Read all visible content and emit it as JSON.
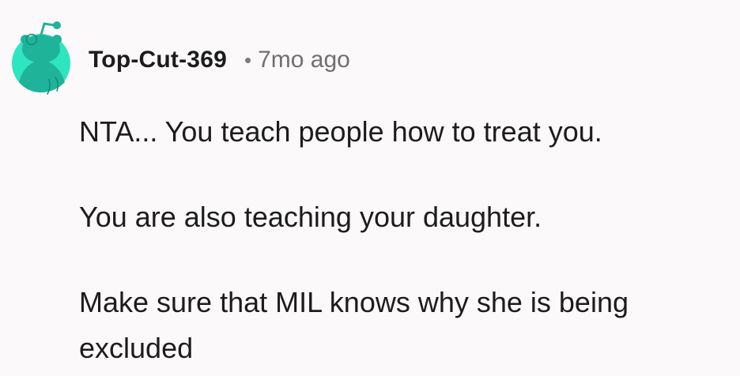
{
  "comment": {
    "author": "Top-Cut-369",
    "separator": "•",
    "age": "7mo ago",
    "paragraphs": [
      "NTA... You teach people how to treat you.",
      "You are also teaching your daughter.",
      "Make sure that MIL knows why she is being excluded"
    ]
  },
  "avatar": {
    "icon": "snoo-avatar-icon",
    "bg_color": "#2ee5c2",
    "body_color": "#1fb39a"
  }
}
